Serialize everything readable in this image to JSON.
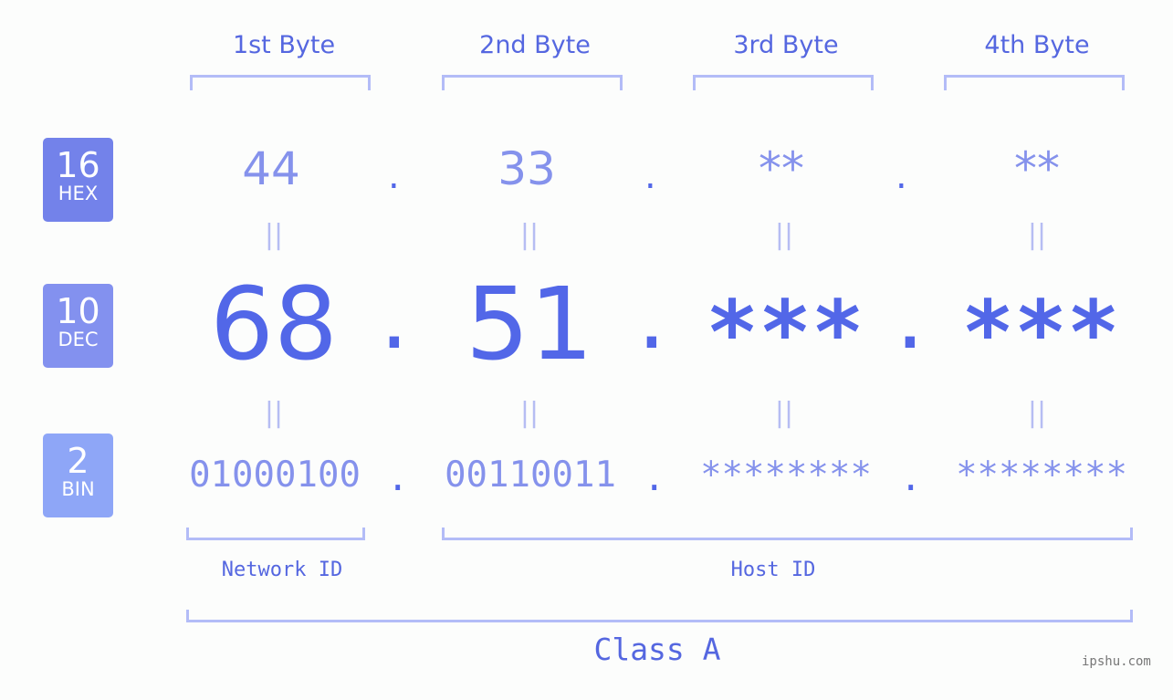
{
  "bytes": {
    "headers": [
      "1st Byte",
      "2nd Byte",
      "3rd Byte",
      "4th Byte"
    ]
  },
  "bases": [
    {
      "number": "16",
      "label": "HEX",
      "color": "#7382ea"
    },
    {
      "number": "10",
      "label": "DEC",
      "color": "#8391ef"
    },
    {
      "number": "2",
      "label": "BIN",
      "color": "#8ea6f7"
    }
  ],
  "hex": [
    "44",
    "33",
    "**",
    "**"
  ],
  "dec": [
    "68",
    "51",
    "***",
    "***"
  ],
  "bin": [
    "01000100",
    "00110011",
    "********",
    "********"
  ],
  "separator": ".",
  "equals": "||",
  "network_id_label": "Network ID",
  "host_id_label": "Host ID",
  "class_label": "Class A",
  "watermark": "ipshu.com",
  "colors": {
    "primary": "#5267e8",
    "light": "#8592ec",
    "bracket": "#b3bcf7"
  }
}
